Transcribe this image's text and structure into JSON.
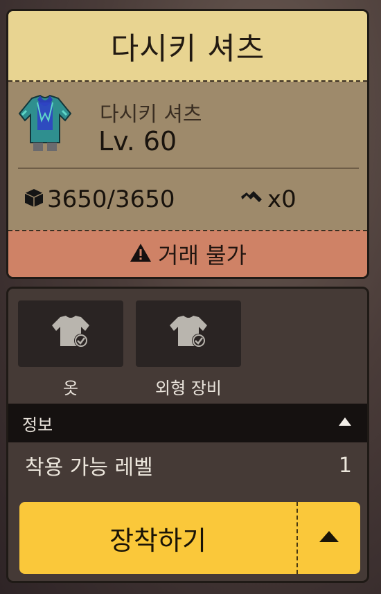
{
  "item": {
    "title": "다시키 셔츠",
    "name": "다시키 셔츠",
    "level": "Lv. 60",
    "durability": "3650/3650",
    "enhance": "x0",
    "trade_status": "거래 불가"
  },
  "categories": [
    {
      "label": "옷",
      "icon": "shirt-check-icon"
    },
    {
      "label": "외형 장비",
      "icon": "shirt-check-icon"
    }
  ],
  "info": {
    "header": "정보",
    "required_level_label": "착용 가능 레벨",
    "required_level_value": "1"
  },
  "actions": {
    "equip_label": "장착하기"
  },
  "colors": {
    "title_bg": "#e8d491",
    "info_bg": "#9e8a6b",
    "trade_bg": "#cf8266",
    "panel_bg": "#453a36",
    "button_yellow": "#fac83a"
  }
}
